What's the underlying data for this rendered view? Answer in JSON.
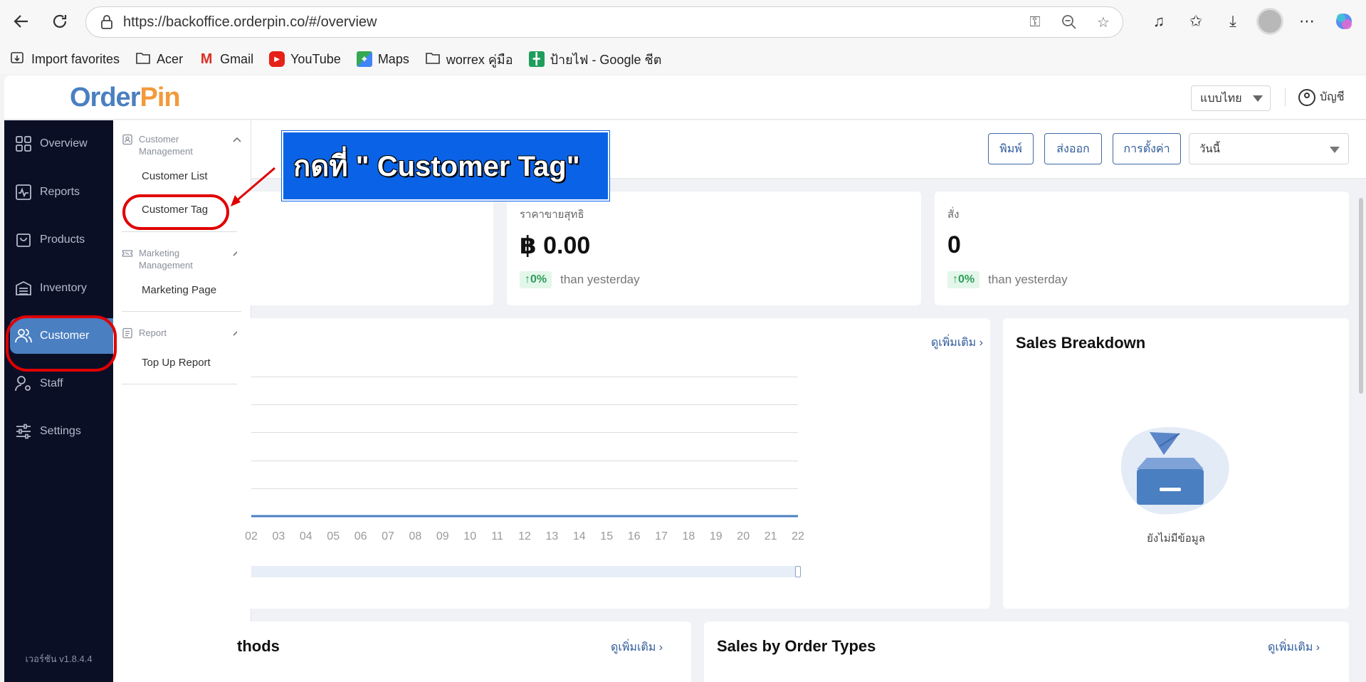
{
  "browser": {
    "url": "https://backoffice.orderpin.co/#/overview",
    "bookmarks": [
      {
        "label": "Import favorites"
      },
      {
        "label": "Acer"
      },
      {
        "label": "Gmail"
      },
      {
        "label": "YouTube"
      },
      {
        "label": "Maps"
      },
      {
        "label": "worrex คู่มือ"
      },
      {
        "label": "ป้ายไฟ - Google ชีต"
      }
    ]
  },
  "header": {
    "logo_part1": "Order",
    "logo_part2": "Pin",
    "language": "แบบไทย",
    "account": "บัญชี"
  },
  "sidebar": {
    "items": [
      {
        "label": "Overview",
        "icon": "grid-icon"
      },
      {
        "label": "Reports",
        "icon": "chart-icon"
      },
      {
        "label": "Products",
        "icon": "bag-icon"
      },
      {
        "label": "Inventory",
        "icon": "warehouse-icon"
      },
      {
        "label": "Customer",
        "icon": "users-icon"
      },
      {
        "label": "Staff",
        "icon": "staff-icon"
      },
      {
        "label": "Settings",
        "icon": "sliders-icon"
      }
    ],
    "active": "Customer",
    "version": "เวอร์ชัน v1.8.4.4"
  },
  "submenu": {
    "groups": [
      {
        "title_line1": "Customer",
        "title_line2": "Management",
        "links": [
          "Customer List",
          "Customer Tag"
        ]
      },
      {
        "title_line1": "Marketing",
        "title_line2": "Management",
        "links": [
          "Marketing Page"
        ]
      },
      {
        "title_line1": "Report",
        "title_line2": "",
        "links": [
          "Top Up Report"
        ]
      }
    ]
  },
  "toolbar": {
    "print": "พิมพ์",
    "export": "ส่งออก",
    "settings": "การตั้งค่า",
    "date_range": "วันนี้"
  },
  "stats": [
    {
      "label": "ราคาขายสุทธิ",
      "value": "฿ 0.00",
      "delta": "↑0%",
      "compare": "than yesterday"
    },
    {
      "label": "สั่ง",
      "value": "0",
      "delta": "↑0%",
      "compare": "than yesterday"
    }
  ],
  "sales_chart": {
    "see_more": "ดูเพิ่มเติม",
    "chart_data": {
      "type": "line",
      "x": [
        "02",
        "03",
        "04",
        "05",
        "06",
        "07",
        "08",
        "09",
        "10",
        "11",
        "12",
        "13",
        "14",
        "15",
        "16",
        "17",
        "18",
        "19",
        "20",
        "21",
        "22"
      ],
      "series": [
        {
          "values": [
            0,
            0,
            0,
            0,
            0,
            0,
            0,
            0,
            0,
            0,
            0,
            0,
            0,
            0,
            0,
            0,
            0,
            0,
            0,
            0,
            0
          ]
        }
      ],
      "color": "#4a7fc1",
      "grid": true
    }
  },
  "sales_breakdown": {
    "title": "Sales Breakdown",
    "empty": "ยังไม่มีข้อมูล"
  },
  "payment_methods": {
    "title_fragment": "thods",
    "see_more": "ดูเพิ่มเติม"
  },
  "order_types": {
    "title": "Sales by Order Types",
    "see_more": "ดูเพิ่มเติม"
  },
  "tutorial": {
    "callout": "กดที่ \" Customer Tag\"",
    "highlight_color": "#e00000"
  }
}
